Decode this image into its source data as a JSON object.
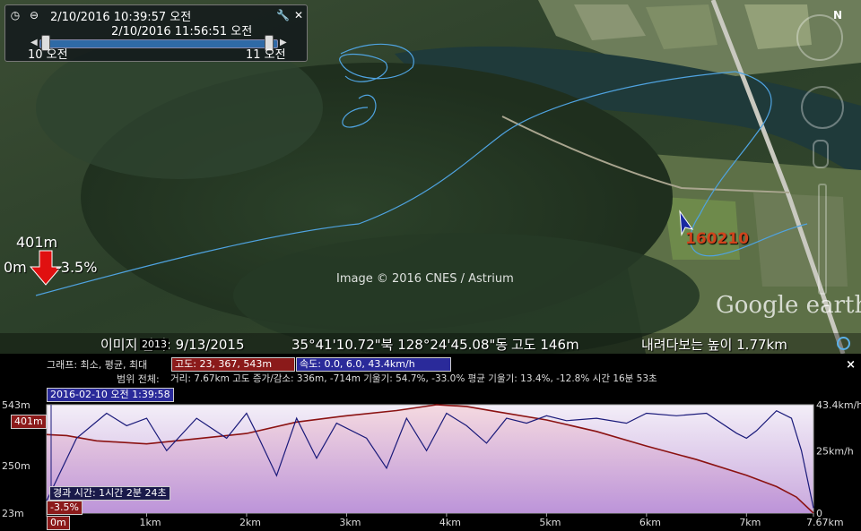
{
  "time_slider": {
    "start_time": "2/10/2016  10:39:57 오전",
    "end_time": "2/10/2016  11:56:51 오전",
    "left_tick": "10 오전",
    "right_tick": "11 오전"
  },
  "map": {
    "attribution": "Image © 2016 CNES / Astrium",
    "logo": "Google earth",
    "placemark_label": "160210",
    "elevation_marker": "401m",
    "distance_marker": "0m",
    "slope_marker": "-3.5%",
    "year_badge": "2013"
  },
  "status_bar": {
    "imagery_date": "이미지 날짜: 9/13/2015",
    "coordinates": "35°41'10.72\"북 128°24'45.08\"동",
    "elevation": "고도   146m",
    "eye_alt": "내려다보는 높이   1.77km"
  },
  "elevation_panel": {
    "graph_summary_label": "그래프: 최소, 평균, 최대",
    "altitude_badge": "고도: 23, 367, 543m",
    "speed_badge": "속도: 0.0, 6.0, 43.4km/h",
    "range_label": "범위 전체:",
    "range_details": "거리: 7.67km 고도 증가/감소: 336m, -714m 기울기: 54.7%, -33.0% 평균 기울기: 13.4%, -12.8% 시간 16분 53초",
    "cursor_time": "2016-02-10 오전 1:39:58",
    "cursor_elev": "401m",
    "cursor_slope": "-3.5%",
    "cursor_distance": "0m",
    "elapsed_label": "경과 시간: 1시간 2분 24초",
    "close_label": "×",
    "colors": {
      "elevation": "#8b1212",
      "speed": "#1a1a7a",
      "altitude_badge_bg": "#8b1a1a",
      "speed_badge_bg": "#2a2a9a"
    }
  },
  "chart_data": {
    "type": "line",
    "x_unit": "km",
    "xlim": [
      0,
      7.67
    ],
    "x_ticks": [
      "0m",
      "1km",
      "2km",
      "3km",
      "4km",
      "5km",
      "6km",
      "7km",
      "7.67km"
    ],
    "y_left_ticks": [
      "543m",
      "401m",
      "250m",
      "23m"
    ],
    "y_left_lim": [
      23,
      543
    ],
    "y_right_ticks": [
      "43.4km/h",
      "25km/h",
      "0"
    ],
    "y_right_lim": [
      0,
      43.4
    ],
    "series": [
      {
        "name": "고도",
        "axis": "left",
        "x": [
          0,
          0.2,
          0.5,
          1.0,
          1.5,
          2.0,
          2.5,
          3.0,
          3.5,
          3.9,
          4.2,
          4.5,
          5.0,
          5.5,
          6.0,
          6.5,
          7.0,
          7.3,
          7.5,
          7.67
        ],
        "values": [
          400,
          395,
          370,
          355,
          380,
          405,
          460,
          490,
          515,
          543,
          535,
          510,
          470,
          415,
          345,
          280,
          205,
          150,
          100,
          23
        ]
      },
      {
        "name": "속도",
        "axis": "right",
        "x": [
          0,
          0.3,
          0.6,
          0.8,
          1.0,
          1.2,
          1.5,
          1.8,
          2.0,
          2.1,
          2.3,
          2.5,
          2.7,
          2.9,
          3.2,
          3.4,
          3.6,
          3.8,
          4.0,
          4.2,
          4.4,
          4.6,
          4.8,
          5.0,
          5.2,
          5.5,
          5.8,
          6.0,
          6.3,
          6.6,
          6.9,
          7.0,
          7.1,
          7.3,
          7.45,
          7.55,
          7.67
        ],
        "values": [
          5,
          30,
          40,
          35,
          38,
          25,
          38,
          30,
          40,
          32,
          15,
          38,
          22,
          36,
          30,
          18,
          38,
          25,
          40,
          35,
          28,
          38,
          36,
          39,
          37,
          38,
          36,
          40,
          39,
          40,
          32,
          30,
          33,
          41,
          38,
          25,
          2
        ]
      }
    ]
  }
}
